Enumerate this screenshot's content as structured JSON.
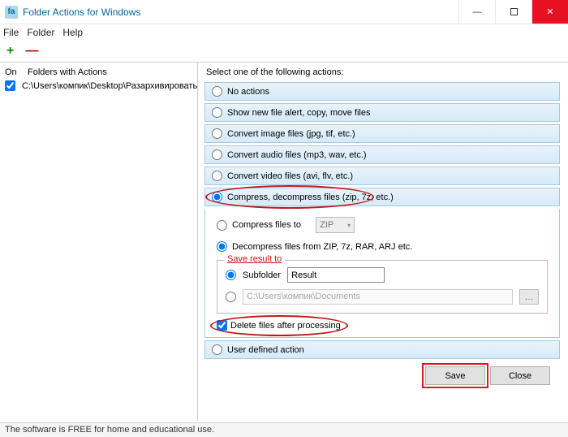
{
  "titlebar": {
    "icon_text": "fa",
    "title": "Folder Actions for Windows"
  },
  "menu": {
    "file": "File",
    "folder": "Folder",
    "help": "Help"
  },
  "toolbar": {
    "add": "+",
    "remove": "—"
  },
  "left": {
    "col_on": "On",
    "col_folders": "Folders with Actions",
    "rows": [
      {
        "checked": true,
        "path": "C:\\Users\\компик\\Desktop\\Разархивировать"
      }
    ]
  },
  "right": {
    "select_label": "Select one of the following actions:",
    "options": {
      "none": "No actions",
      "alert": "Show new file alert, copy, move files",
      "image": "Convert image files (jpg, tif, etc.)",
      "audio": "Convert audio files (mp3, wav, etc.)",
      "video": "Convert video files (avi, flv, etc.)",
      "compress": "Compress, decompress files (zip, 7z, etc.)",
      "user": "User defined action"
    },
    "selected": "compress",
    "compress_panel": {
      "compress_to": "Compress files to",
      "compress_format": "ZIP",
      "decompress_from": "Decompress files from  ZIP, 7z, RAR, ARJ etc.",
      "sub_selected": "decompress",
      "save_result_to": "Save result to",
      "subfolder_label": "Subfolder",
      "subfolder_value": "Result",
      "other_path": "C:\\Users\\компик\\Documents",
      "result_selected": "subfolder",
      "delete_after": "Delete files after processing",
      "delete_checked": true
    }
  },
  "buttons": {
    "save": "Save",
    "close": "Close"
  },
  "status": "The software is FREE for home and educational use."
}
